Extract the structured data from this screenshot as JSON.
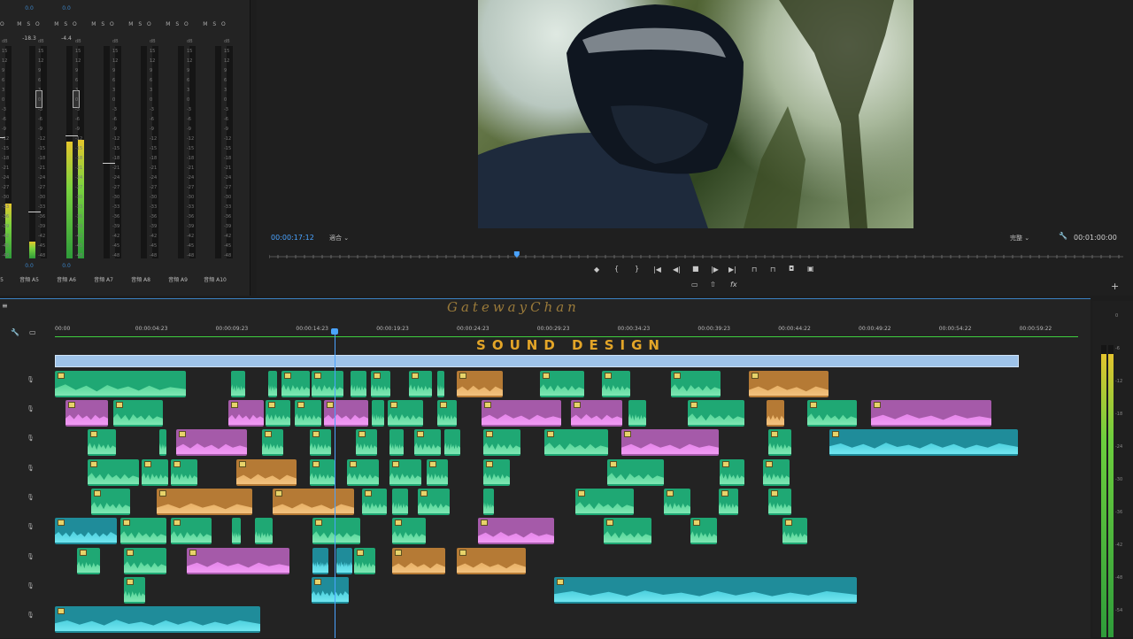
{
  "mixer": {
    "channels": [
      {
        "id": "ch1",
        "name": "音頻",
        "label": "A5",
        "val": "0.0",
        "peak": "",
        "top": "0.0"
      },
      {
        "id": "ch2",
        "name": "音頻",
        "label": "A5",
        "val": "0.0",
        "peak": "-18.3",
        "top": "0.0"
      },
      {
        "id": "ch3",
        "name": "音頻",
        "label": "A6",
        "val": "0.0",
        "peak": "-4.4",
        "top": "0.0"
      },
      {
        "id": "ch4",
        "name": "音頻",
        "label": "A7",
        "val": "",
        "peak": "",
        "top": ""
      },
      {
        "id": "ch5",
        "name": "音頻",
        "label": "A8",
        "val": "",
        "peak": "",
        "top": ""
      },
      {
        "id": "ch6",
        "name": "音頻",
        "label": "A9",
        "val": "",
        "peak": "",
        "top": ""
      },
      {
        "id": "ch7",
        "name": "音頻",
        "label": "A10",
        "val": "",
        "peak": "",
        "top": ""
      }
    ],
    "msr": "M S O",
    "scale": [
      "dB",
      "15",
      "12",
      "9",
      "6",
      "3",
      "0",
      "-3",
      "-6",
      "-9",
      "-12",
      "-15",
      "-18",
      "-21",
      "-24",
      "-27",
      "-30",
      "-33",
      "-36",
      "-39",
      "-42",
      "-45",
      "-48"
    ]
  },
  "monitor": {
    "timecode_left": "00:00:17:12",
    "fit": "適合",
    "quality": "完整",
    "timecode_right": "00:01:00:00",
    "playback_progress": 0.29
  },
  "timeline": {
    "watermark": "GatewayChan",
    "title": "SOUND DESIGN",
    "ticks": [
      "00:00",
      "00:00:04:23",
      "00:00:09:23",
      "00:00:14:23",
      "00:00:19:23",
      "00:00:24:23",
      "00:00:29:23",
      "00:00:34:23",
      "00:00:39:23",
      "00:00:44:22",
      "00:00:49:22",
      "00:00:54:22",
      "00:00:59:22"
    ],
    "track_label": "S"
  },
  "master_meter": {
    "scale": [
      "0",
      "-6",
      "-12",
      "-18",
      "-24",
      "-30",
      "-36",
      "-42",
      "-48",
      "-54"
    ],
    "level": 0.97
  }
}
